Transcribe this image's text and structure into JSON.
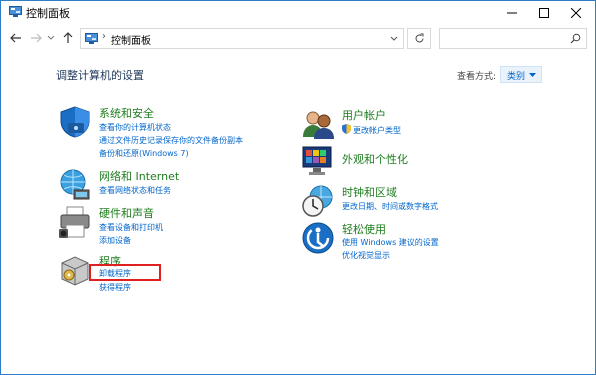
{
  "window": {
    "title": "控制面板"
  },
  "address": {
    "path": "控制面板",
    "search_placeholder": ""
  },
  "main": {
    "heading": "调整计算机的设置",
    "view_by_label": "查看方式:",
    "view_by_value": "类别"
  },
  "categories": {
    "system_security": {
      "title": "系统和安全",
      "links": [
        "查看你的计算机状态",
        "通过文件历史记录保存你的文件备份副本",
        "备份和还原(Windows 7)"
      ]
    },
    "network": {
      "title": "网络和 Internet",
      "links": [
        "查看网络状态和任务"
      ]
    },
    "hardware": {
      "title": "硬件和声音",
      "links": [
        "查看设备和打印机",
        "添加设备"
      ]
    },
    "programs": {
      "title": "程序",
      "links": [
        "卸载程序",
        "获得程序"
      ]
    },
    "user_accounts": {
      "title": "用户帐户",
      "links": [
        "更改帐户类型"
      ]
    },
    "appearance": {
      "title": "外观和个性化",
      "links": []
    },
    "clock_region": {
      "title": "时钟和区域",
      "links": [
        "更改日期、时间或数字格式"
      ]
    },
    "ease_of_access": {
      "title": "轻松使用",
      "links": [
        "使用 Windows 建议的设置",
        "优化视觉显示"
      ]
    }
  },
  "colors": {
    "link": "#0066cc",
    "category_title": "#1e7d1e",
    "highlight_box": "#e02020",
    "window_border": "#2d7cc6"
  },
  "icons": [
    "control-panel-icon",
    "back-icon",
    "forward-icon",
    "recent-locations-icon",
    "up-icon",
    "chevron-down-icon",
    "refresh-icon",
    "search-icon",
    "minimize-icon",
    "maximize-icon",
    "close-icon",
    "shield-icon",
    "globe-network-icon",
    "printer-icon",
    "programs-box-icon",
    "users-icon",
    "palette-monitor-icon",
    "clock-globe-icon",
    "accessibility-icon",
    "uac-shield-icon"
  ]
}
